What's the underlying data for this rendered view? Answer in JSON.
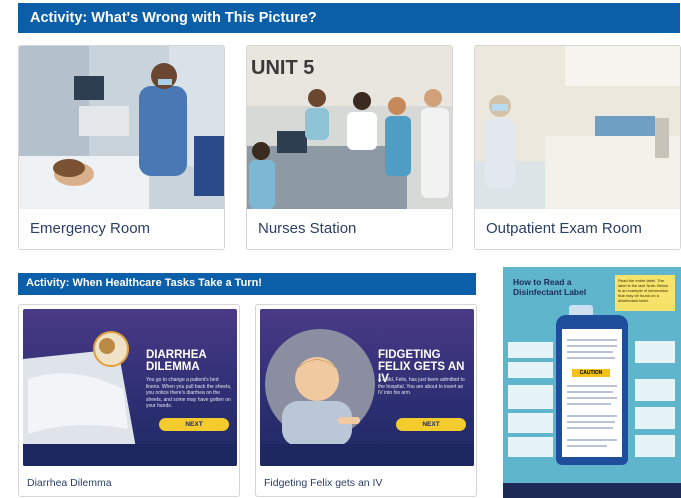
{
  "activity_top": {
    "title": "Activity: What's Wrong with This Picture?"
  },
  "top_cards": [
    {
      "caption": "Emergency Room"
    },
    {
      "caption": "Nurses Station"
    },
    {
      "caption": "Outpatient Exam Room"
    }
  ],
  "nurses_station": {
    "sign": "UNIT 5"
  },
  "activity_mid": {
    "title": "Activity: When Healthcare Tasks Take a Turn!"
  },
  "bottom_cards": [
    {
      "slide_title": "DIARRHEA DILEMMA",
      "slide_text": "You go to change a patient's bed linens. When you pull back the sheets, you notice there's diarrhea on the sheets, and some may have gotten on your hands.",
      "next_label": "NEXT",
      "caption": "Diarrhea Dilemma"
    },
    {
      "slide_title": "FIDGETING FELIX GETS AN IV",
      "slide_text": "A child, Felix, has just been admitted to the hospital. You are about to insert an IV into his arm.",
      "next_label": "NEXT",
      "caption": "Fidgeting Felix gets an IV"
    }
  ],
  "poster": {
    "title": "How to Read a Disinfectant Label",
    "note": "Read the entire label. The label is the law! Note: Below is an example of information that may be found on a disinfectant label.",
    "caution": "CAUTION"
  },
  "colors": {
    "banner": "#0b5ea8",
    "caption": "#2a3f66",
    "slide_bg": "#2e2f74",
    "next_button": "#f3cb2d"
  }
}
